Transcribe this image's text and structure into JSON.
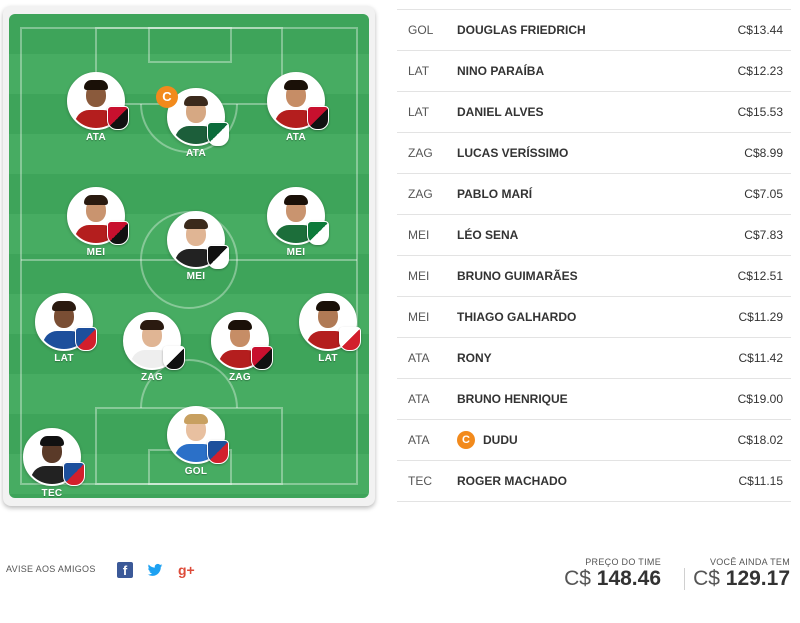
{
  "field": {
    "players": [
      {
        "pos": "ATA",
        "shirt": "#b41e1e",
        "skin": "#8a5a3c",
        "hair": "#1a1008",
        "club": "flamengo"
      },
      {
        "pos": "ATA",
        "shirt": "#1c5e3a",
        "skin": "#d6a883",
        "hair": "#3b2a1c",
        "club": "palmeiras",
        "captain": "C"
      },
      {
        "pos": "ATA",
        "shirt": "#b41e1e",
        "skin": "#c68d66",
        "hair": "#1a1008",
        "club": "athletico"
      },
      {
        "pos": "MEI",
        "shirt": "#b41e1e",
        "skin": "#c9946f",
        "hair": "#2a1a10",
        "club": "athletico"
      },
      {
        "pos": "MEI",
        "shirt": "#222222",
        "skin": "#e0b594",
        "hair": "#3b2a1c",
        "club": "ceara"
      },
      {
        "pos": "MEI",
        "shirt": "#1c6e3a",
        "skin": "#c9946f",
        "hair": "#1a1008",
        "club": "goias",
        "club_letter": "G"
      },
      {
        "pos": "LAT",
        "shirt": "#1d4f9c",
        "skin": "#7a4e34",
        "hair": "#2a1a10",
        "club": "bahia"
      },
      {
        "pos": "ZAG",
        "shirt": "#eeeeee",
        "skin": "#e0b594",
        "hair": "#2a1a10",
        "club": "santos"
      },
      {
        "pos": "ZAG",
        "shirt": "#b41e1e",
        "skin": "#c68d66",
        "hair": "#1a1008",
        "club": "flamengo"
      },
      {
        "pos": "LAT",
        "shirt": "#b41e1e",
        "skin": "#b07a55",
        "hair": "#1a1008",
        "club": "saopaulo",
        "club_letter": "SPFC"
      },
      {
        "pos": "GOL",
        "shirt": "#2b70c8",
        "skin": "#e8c0a0",
        "hair": "#c8a060",
        "club": "bahia"
      },
      {
        "pos": "TEC",
        "shirt": "#222222",
        "skin": "#5a3a28",
        "hair": "#111111",
        "club": "bahia"
      }
    ]
  },
  "team_list": [
    {
      "pos": "GOL",
      "name": "DOUGLAS FRIEDRICH",
      "price": "C$13.44"
    },
    {
      "pos": "LAT",
      "name": "NINO PARAÍBA",
      "price": "C$12.23"
    },
    {
      "pos": "LAT",
      "name": "DANIEL ALVES",
      "price": "C$15.53"
    },
    {
      "pos": "ZAG",
      "name": "LUCAS VERÍSSIMO",
      "price": "C$8.99"
    },
    {
      "pos": "ZAG",
      "name": "PABLO MARÍ",
      "price": "C$7.05"
    },
    {
      "pos": "MEI",
      "name": "LÉO SENA",
      "price": "C$7.83"
    },
    {
      "pos": "MEI",
      "name": "BRUNO GUIMARÃES",
      "price": "C$12.51"
    },
    {
      "pos": "MEI",
      "name": "THIAGO GALHARDO",
      "price": "C$11.29"
    },
    {
      "pos": "ATA",
      "name": "RONY",
      "price": "C$11.42"
    },
    {
      "pos": "ATA",
      "name": "BRUNO HENRIQUE",
      "price": "C$19.00"
    },
    {
      "pos": "ATA",
      "name": "DUDU",
      "price": "C$18.02",
      "captain": "C"
    },
    {
      "pos": "TEC",
      "name": "ROGER MACHADO",
      "price": "C$11.15"
    }
  ],
  "share": {
    "label": "AVISE AOS AMIGOS",
    "icons": [
      "facebook-icon",
      "twitter-icon",
      "google-plus-icon"
    ],
    "facebook_glyph": "f",
    "googleplus_glyph": "g+"
  },
  "totals": {
    "team_price_label": "PREÇO DO TIME",
    "team_price_currency": "C$",
    "team_price_value": "148.46",
    "remaining_label": "VOCÊ AINDA TEM",
    "remaining_currency": "C$",
    "remaining_value": "129.17"
  },
  "colors": {
    "pitch_dark": "#3ea45a",
    "pitch_light": "#47ac62",
    "captain_orange": "#f28a1c"
  }
}
